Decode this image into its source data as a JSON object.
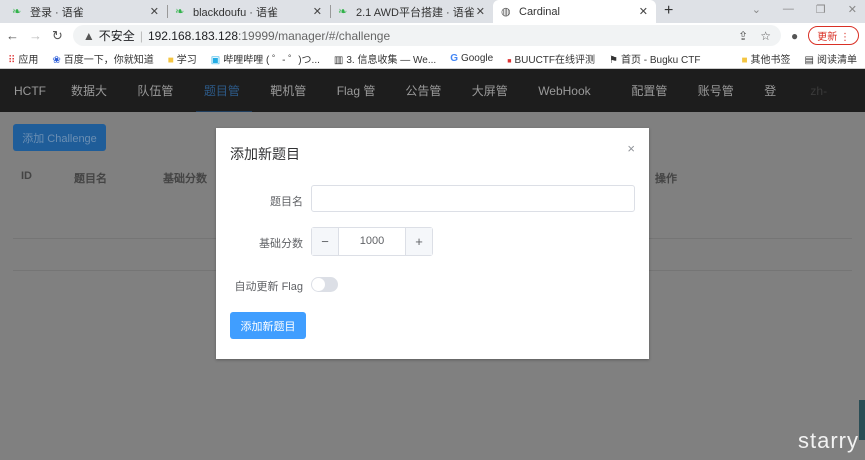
{
  "browser": {
    "tabs": [
      {
        "label": "登录 · 语雀",
        "icon": "yuque-icon"
      },
      {
        "label": "blackdoufu · 语雀",
        "icon": "yuque-icon"
      },
      {
        "label": "2.1 AWD平台搭建 · 语雀",
        "icon": "yuque-icon"
      },
      {
        "label": "Cardinal",
        "icon": "globe-icon",
        "active": true
      }
    ],
    "new_tab": "+",
    "address": {
      "security": "不安全",
      "host": "192.168.183.128",
      "path": ":19999/manager/#/challenge"
    },
    "update_label": "更新",
    "bookmarks": [
      "应用",
      "百度一下，你就知道",
      "学习",
      "哔哩哔哩 ( ゜- ゜)つ...",
      "3. 信息收集 — We...",
      "Google",
      "BUUCTF在线评测",
      "首页 - Bugku CTF"
    ],
    "bookmarks_right": [
      "其他书签",
      "阅读清单"
    ]
  },
  "nav": {
    "items": [
      "HCTF",
      "数据大屏",
      "队伍管理",
      "题目管理",
      "靶机管理",
      "Flag 管理",
      "公告管理",
      "大屏管理",
      "WebHook 管理",
      "配置管理",
      "账号管理",
      "登出",
      "zh-CN"
    ],
    "active": 3
  },
  "page": {
    "add_button": "添加 Challenge",
    "columns": [
      "ID",
      "题目名",
      "基础分数",
      "操作"
    ]
  },
  "modal": {
    "title": "添加新题目",
    "close": "×",
    "fields": {
      "name_label": "题目名",
      "name_value": "",
      "score_label": "基础分数",
      "score_value": "1000",
      "minus": "−",
      "plus": "+",
      "auto_flag_label": "自动更新 Flag",
      "auto_flag": false
    },
    "submit": "添加新题目"
  },
  "watermark": "starry"
}
